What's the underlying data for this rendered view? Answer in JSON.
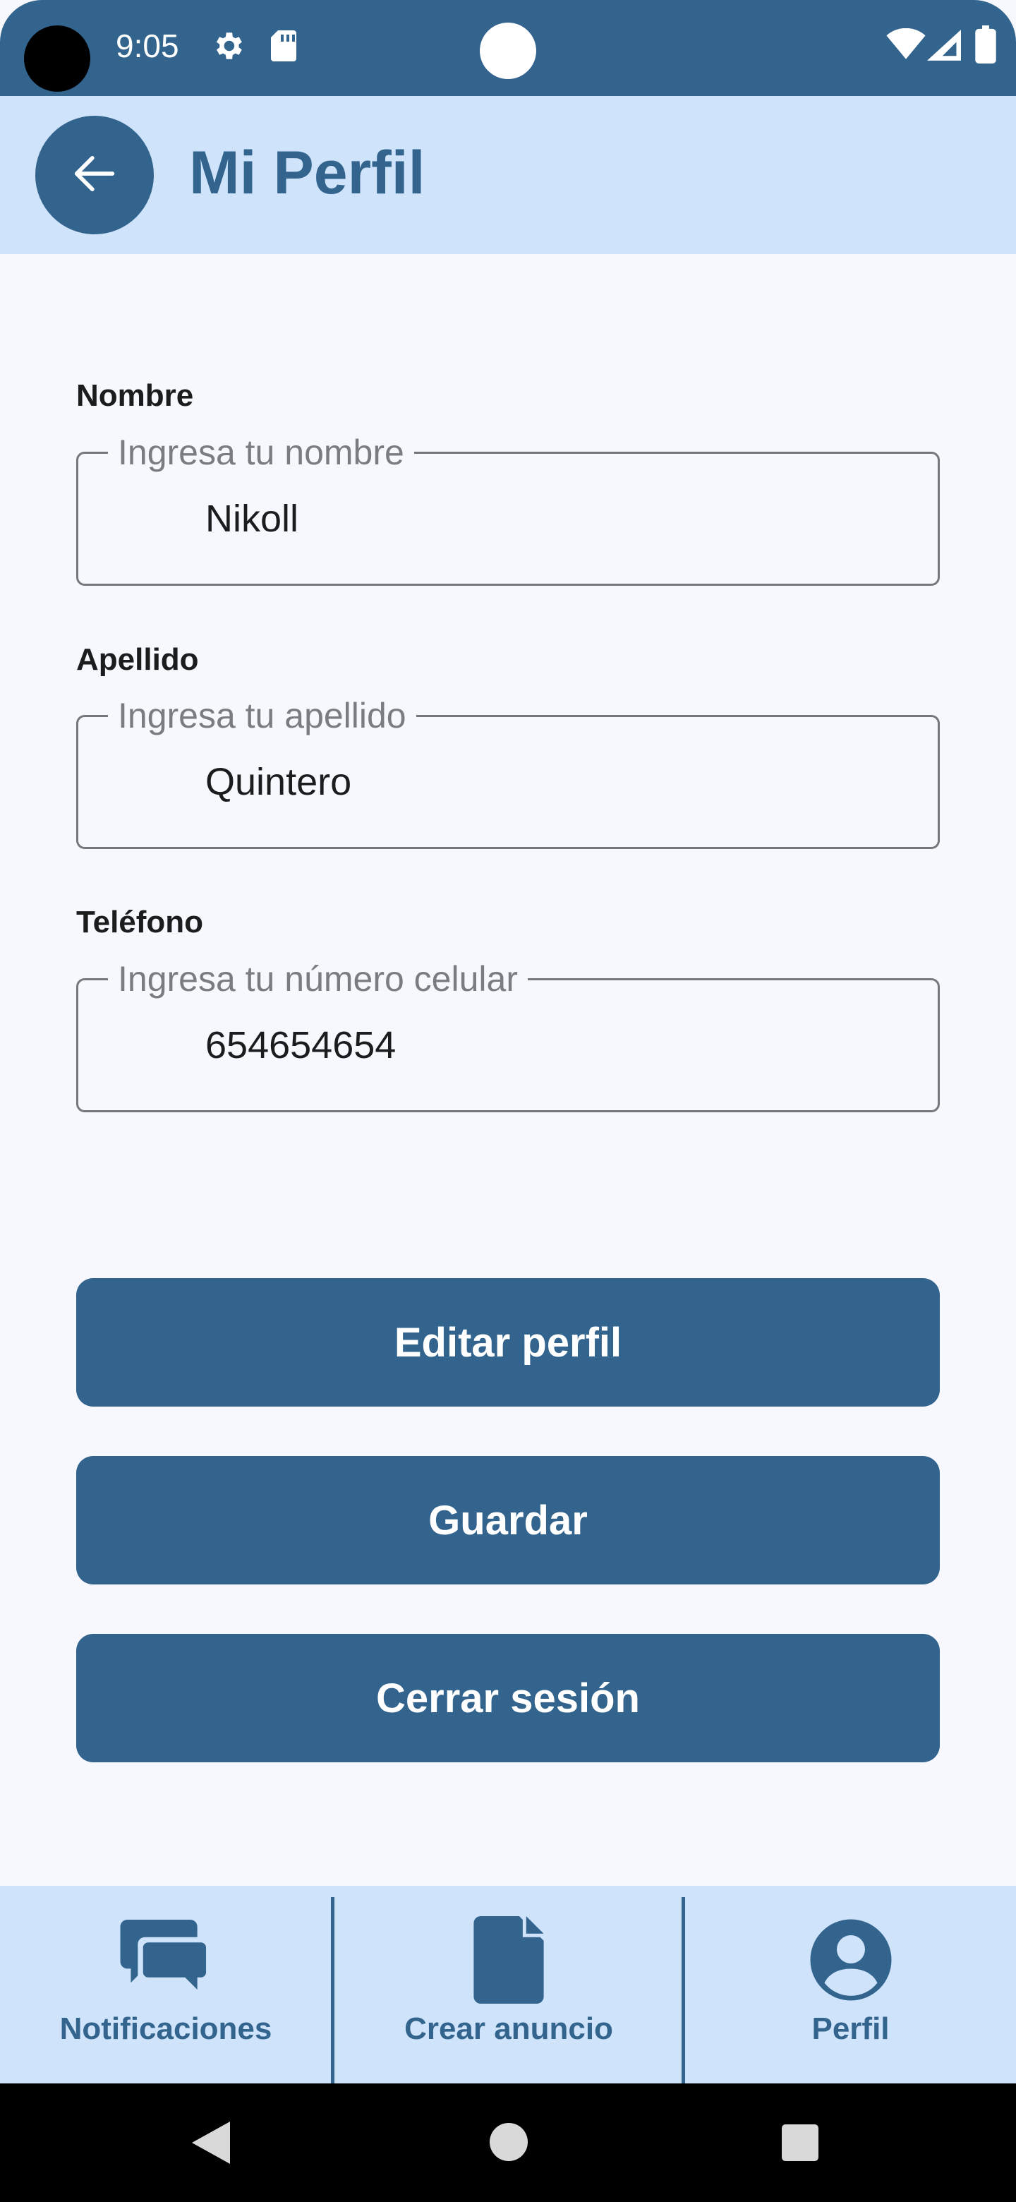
{
  "status_bar": {
    "time": "9:05",
    "icons": [
      "gear-icon",
      "sd-card-icon",
      "wifi-icon",
      "signal-icon",
      "battery-icon"
    ]
  },
  "app_bar": {
    "title": "Mi Perfil",
    "back_icon": "arrow-left-icon"
  },
  "form": {
    "fields": [
      {
        "label": "Nombre",
        "placeholder": "Ingresa tu nombre",
        "value": "Nikoll"
      },
      {
        "label": "Apellido",
        "placeholder": "Ingresa tu apellido",
        "value": "Quintero"
      },
      {
        "label": "Teléfono",
        "placeholder": "Ingresa tu número celular",
        "value": "654654654"
      }
    ]
  },
  "actions": {
    "edit_label": "Editar perfil",
    "save_label": "Guardar",
    "logout_label": "Cerrar sesión"
  },
  "bottom_nav": {
    "items": [
      {
        "label": "Notificaciones",
        "icon": "chat-bubbles-icon"
      },
      {
        "label": "Crear anuncio",
        "icon": "document-icon"
      },
      {
        "label": "Perfil",
        "icon": "account-circle-icon"
      }
    ]
  },
  "colors": {
    "primary": "#32648e",
    "surface_container": "#cfe3fb",
    "background": "#f6f8fd"
  }
}
